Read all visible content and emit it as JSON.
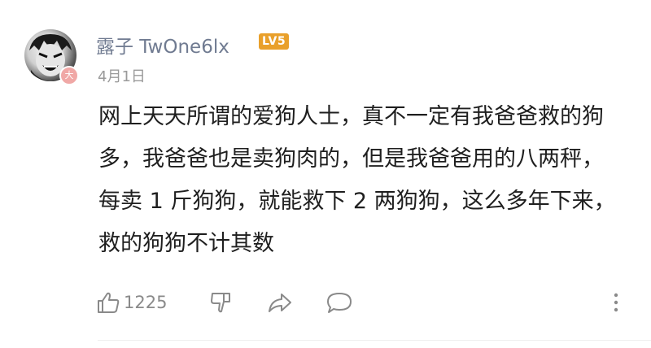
{
  "comment": {
    "username": "露子 TwOne6lx",
    "level_badge": "LV5",
    "vip_badge": "大",
    "date": "4月1日",
    "text": "网上天天所谓的爱狗人士，真不一定有我爸爸救的狗多，我爸爸也是卖狗肉的，但是我爸爸用的八两秤，每卖 1 斤狗狗，就能救下 2 两狗狗，这么多年下来，救的狗狗不计其数",
    "like_count": "1225"
  },
  "icons": {
    "like": "thumbs-up-icon",
    "dislike": "thumbs-down-icon",
    "share": "share-icon",
    "reply": "comment-icon",
    "more": "more-icon"
  },
  "colors": {
    "username": "#707b91",
    "level_badge": "#e9a02b",
    "vip_badge": "#f0a8a6",
    "icon": "#8a8a8a"
  }
}
